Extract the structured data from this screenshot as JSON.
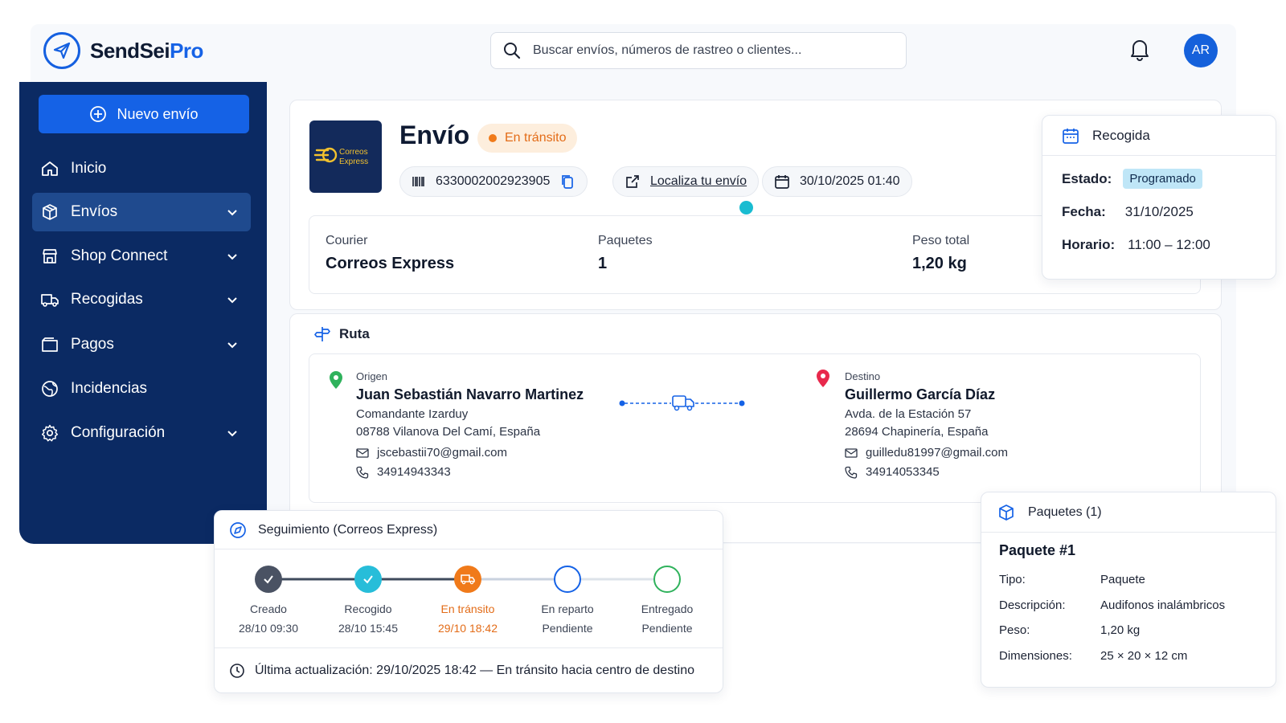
{
  "app": {
    "name_main": "SendSei",
    "name_accent": "Pro"
  },
  "search": {
    "placeholder": "Buscar envíos, números de rastreo o clientes..."
  },
  "user": {
    "initials": "AR"
  },
  "colors": {
    "primary": "#1562e6",
    "sidebar": "#0b2a63",
    "in_transit": "#f07a1a",
    "done": "#27bdd9",
    "delivered_ring": "#2fb25c"
  },
  "sidebar": {
    "new_button": "Nuevo envío",
    "items": [
      {
        "label": "Inicio",
        "icon": "home-icon",
        "has_chevron": false,
        "active": false
      },
      {
        "label": "Envíos",
        "icon": "box-icon",
        "has_chevron": true,
        "active": true
      },
      {
        "label": "Shop Connect",
        "icon": "store-icon",
        "has_chevron": true,
        "active": false
      },
      {
        "label": "Recogidas",
        "icon": "truck-icon",
        "has_chevron": true,
        "active": false
      },
      {
        "label": "Pagos",
        "icon": "wallet-icon",
        "has_chevron": true,
        "active": false
      },
      {
        "label": "Incidencias",
        "icon": "globe-icon",
        "has_chevron": false,
        "active": false
      },
      {
        "label": "Configuración",
        "icon": "gear-icon",
        "has_chevron": true,
        "active": false
      }
    ]
  },
  "shipment": {
    "title": "Envío",
    "status": "En tránsito",
    "courier_logo_text": [
      "Correos",
      "Express"
    ],
    "tracking_number": "6330002002923905",
    "track_link": "Localiza tu envío",
    "date": "30/10/2025 01:40",
    "courier_label": "Courier",
    "courier_value": "Correos Express",
    "packages_label": "Paquetes",
    "packages_value": "1",
    "weight_label": "Peso total",
    "weight_value": "1,20 kg"
  },
  "pickup": {
    "title": "Recogida",
    "status_label": "Estado:",
    "status_value": "Programado",
    "date_label": "Fecha:",
    "date_value": "31/10/2025",
    "time_label": "Horario:",
    "time_value": "11:00 – 12:00"
  },
  "route": {
    "title": "Ruta",
    "origin": {
      "label": "Origen",
      "name": "Juan Sebastián Navarro Martinez",
      "address1": "Comandante Izarduy",
      "address2": "08788 Vilanova Del Camí, España",
      "email": "jscebastii70@gmail.com",
      "phone": "34914943343"
    },
    "destination": {
      "label": "Destino",
      "name": "Guillermo García Díaz",
      "address1": "Avda. de la Estación 57",
      "address2": "28694 Chapinería, España",
      "email": "guilledu81997@gmail.com",
      "phone": "34914053345"
    }
  },
  "tracking": {
    "title": "Seguimiento (Correos Express)",
    "steps": [
      {
        "name": "Creado",
        "time": "28/10 09:30",
        "state": "done"
      },
      {
        "name": "Recogido",
        "time": "28/10 15:45",
        "state": "done"
      },
      {
        "name": "En tránsito",
        "time": "29/10 18:42",
        "state": "current"
      },
      {
        "name": "En reparto",
        "time": "Pendiente",
        "state": "pending"
      },
      {
        "name": "Entregado",
        "time": "Pendiente",
        "state": "pending"
      }
    ],
    "last_update": "Última actualización: 29/10/2025 18:42 — En tránsito hacia centro de destino"
  },
  "packages": {
    "title": "Paquetes (1)",
    "item_title": "Paquete #1",
    "rows": [
      {
        "k": "Tipo:",
        "v": "Paquete"
      },
      {
        "k": "Descripción:",
        "v": "Audifonos inalámbricos"
      },
      {
        "k": "Peso:",
        "v": "1,20 kg"
      },
      {
        "k": "Dimensiones:",
        "v": "25 × 20 × 12 cm"
      }
    ]
  }
}
